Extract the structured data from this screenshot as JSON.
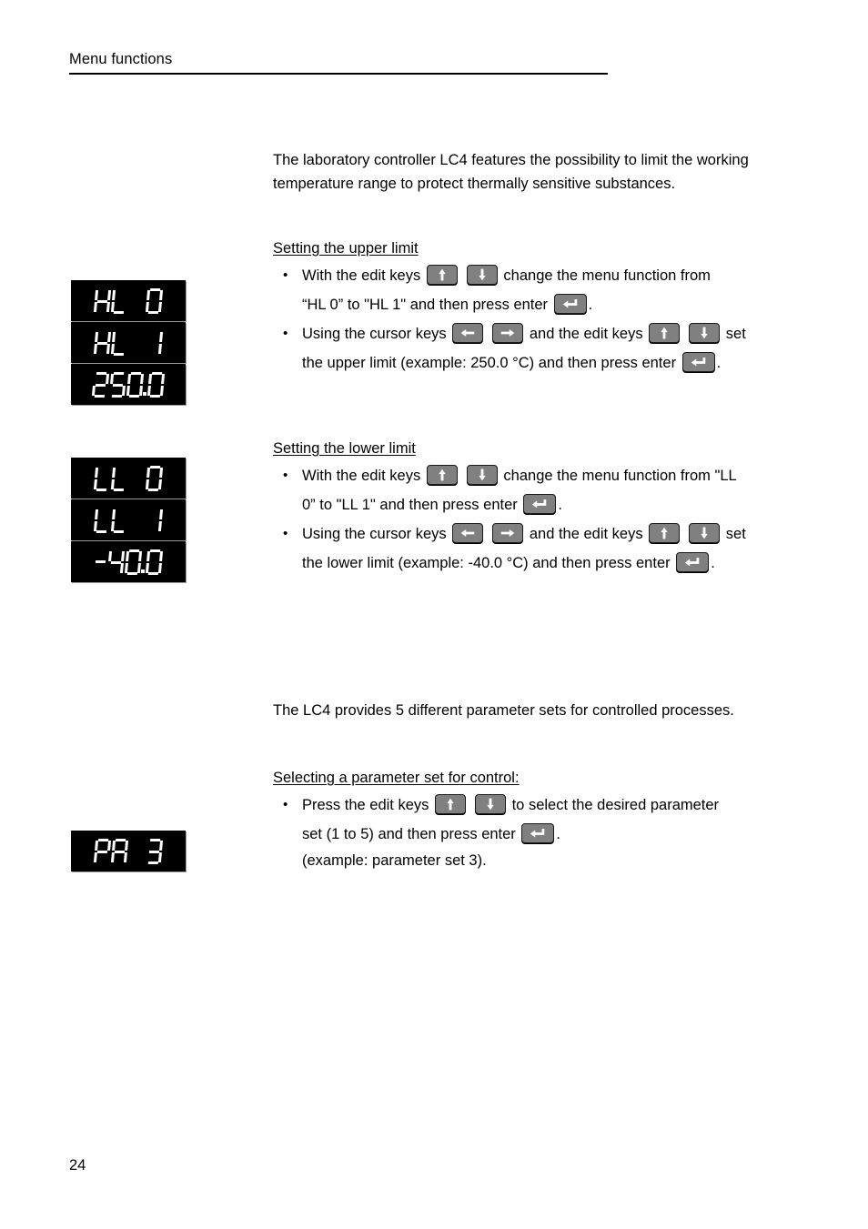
{
  "header": {
    "title": "Menu functions"
  },
  "page_number": "24",
  "colors": {
    "key_face": "#808080",
    "key_border": "#1a1a1a",
    "led_background": "#000000",
    "led_segment": "#ffffff",
    "text": "#000000"
  },
  "intro": {
    "paragraph": "The laboratory controller LC4 features the possibility to limit the working temperature range to protect thermally sensitive substances."
  },
  "upper_limit": {
    "subhead": "Setting the upper limit",
    "bullet1": {
      "line1_part1": "With the edit keys",
      "line1_part2": "change the menu function from",
      "line2_part1": "“HL 0” to \"HL 1\"  and then press enter",
      "line2_part2": "."
    },
    "bullet2": {
      "line1_part1": "Using the cursor keys",
      "line1_part2": "and the edit keys",
      "line1_part3": "set",
      "line2_part1": "the upper limit (example: 250.0 °C) and then press enter",
      "line2_part2": "."
    },
    "displays": [
      {
        "name": "hl-0",
        "text": "HL    0"
      },
      {
        "name": "hl-1",
        "text": "HL    1"
      },
      {
        "name": "value-250-0",
        "text": "250.0"
      }
    ]
  },
  "lower_limit": {
    "subhead": "Setting the lower limit",
    "bullet1": {
      "line1_part1": "With the edit keys",
      "line1_part2": "change the menu function from \"LL",
      "line2_part1": "0” to \"LL 1\"  and then press enter",
      "line2_part2": "."
    },
    "bullet2": {
      "line1_part1": "Using the cursor keys",
      "line1_part2": "and the edit keys",
      "line1_part3": "set",
      "line2_part1": "the lower limit (example: -40.0 °C) and then press enter",
      "line2_part2": "."
    },
    "displays": [
      {
        "name": "ll-0",
        "text": "LL    0"
      },
      {
        "name": "ll-1",
        "text": "LL    1"
      },
      {
        "name": "value-minus-40-0",
        "text": "-40.0"
      }
    ]
  },
  "parameter_sets": {
    "paragraph": "The LC4 provides 5 different parameter sets for controlled processes.",
    "subhead": "Selecting a parameter set for control:",
    "bullet1": {
      "line1_part1": "Press the edit keys",
      "line1_part2": "to select the desired parameter",
      "line2_part1": "set (1 to 5) and then press enter",
      "line2_part2": ".",
      "line3": "(example: parameter set 3)."
    },
    "displays": [
      {
        "name": "pa-3",
        "text": "PA    3"
      }
    ]
  },
  "keys": {
    "up": "edit-key-up",
    "down": "edit-key-down",
    "left": "cursor-key-left",
    "right": "cursor-key-right",
    "enter": "enter-key"
  }
}
